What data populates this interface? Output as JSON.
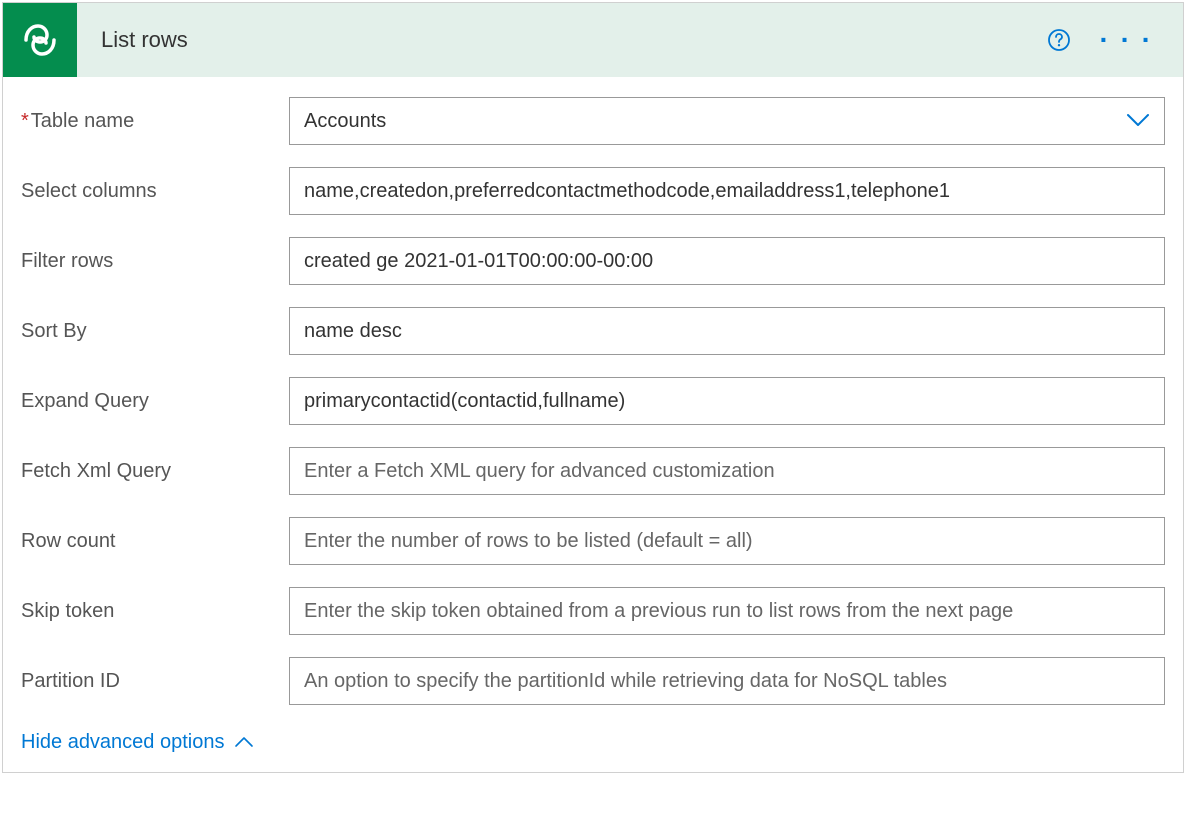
{
  "header": {
    "title": "List rows"
  },
  "fields": {
    "table_name": {
      "label": "Table name",
      "value": "Accounts",
      "required": true
    },
    "select_columns": {
      "label": "Select columns",
      "value": "name,createdon,preferredcontactmethodcode,emailaddress1,telephone1"
    },
    "filter_rows": {
      "label": "Filter rows",
      "value": "created ge 2021-01-01T00:00:00-00:00"
    },
    "sort_by": {
      "label": "Sort By",
      "value": "name desc"
    },
    "expand_query": {
      "label": "Expand Query",
      "value": "primarycontactid(contactid,fullname)"
    },
    "fetch_xml": {
      "label": "Fetch Xml Query",
      "placeholder": "Enter a Fetch XML query for advanced customization"
    },
    "row_count": {
      "label": "Row count",
      "placeholder": "Enter the number of rows to be listed (default = all)"
    },
    "skip_token": {
      "label": "Skip token",
      "placeholder": "Enter the skip token obtained from a previous run to list rows from the next page"
    },
    "partition_id": {
      "label": "Partition ID",
      "placeholder": "An option to specify the partitionId while retrieving data for NoSQL tables"
    }
  },
  "advanced_toggle": {
    "label": "Hide advanced options"
  }
}
